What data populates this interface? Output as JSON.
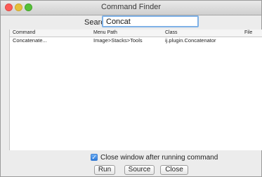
{
  "window": {
    "title": "Command Finder"
  },
  "search": {
    "label": "Search:",
    "value": "Concat"
  },
  "table": {
    "columns": [
      "Command",
      "Menu Path",
      "Class",
      "File"
    ],
    "rows": [
      {
        "command": "Concatenate...",
        "menu_path": "Image>Stacks>Tools",
        "class": "ij.plugin.Concatenator",
        "file": ""
      }
    ]
  },
  "options": {
    "close_after_run_label": "Close window after running command",
    "close_after_run_checked": true
  },
  "buttons": {
    "run": "Run",
    "source": "Source",
    "close": "Close"
  },
  "colors": {
    "close": "#fc5b57",
    "minimize": "#e5bf3c",
    "zoom": "#57c038",
    "focus": "#7fb1e6"
  }
}
